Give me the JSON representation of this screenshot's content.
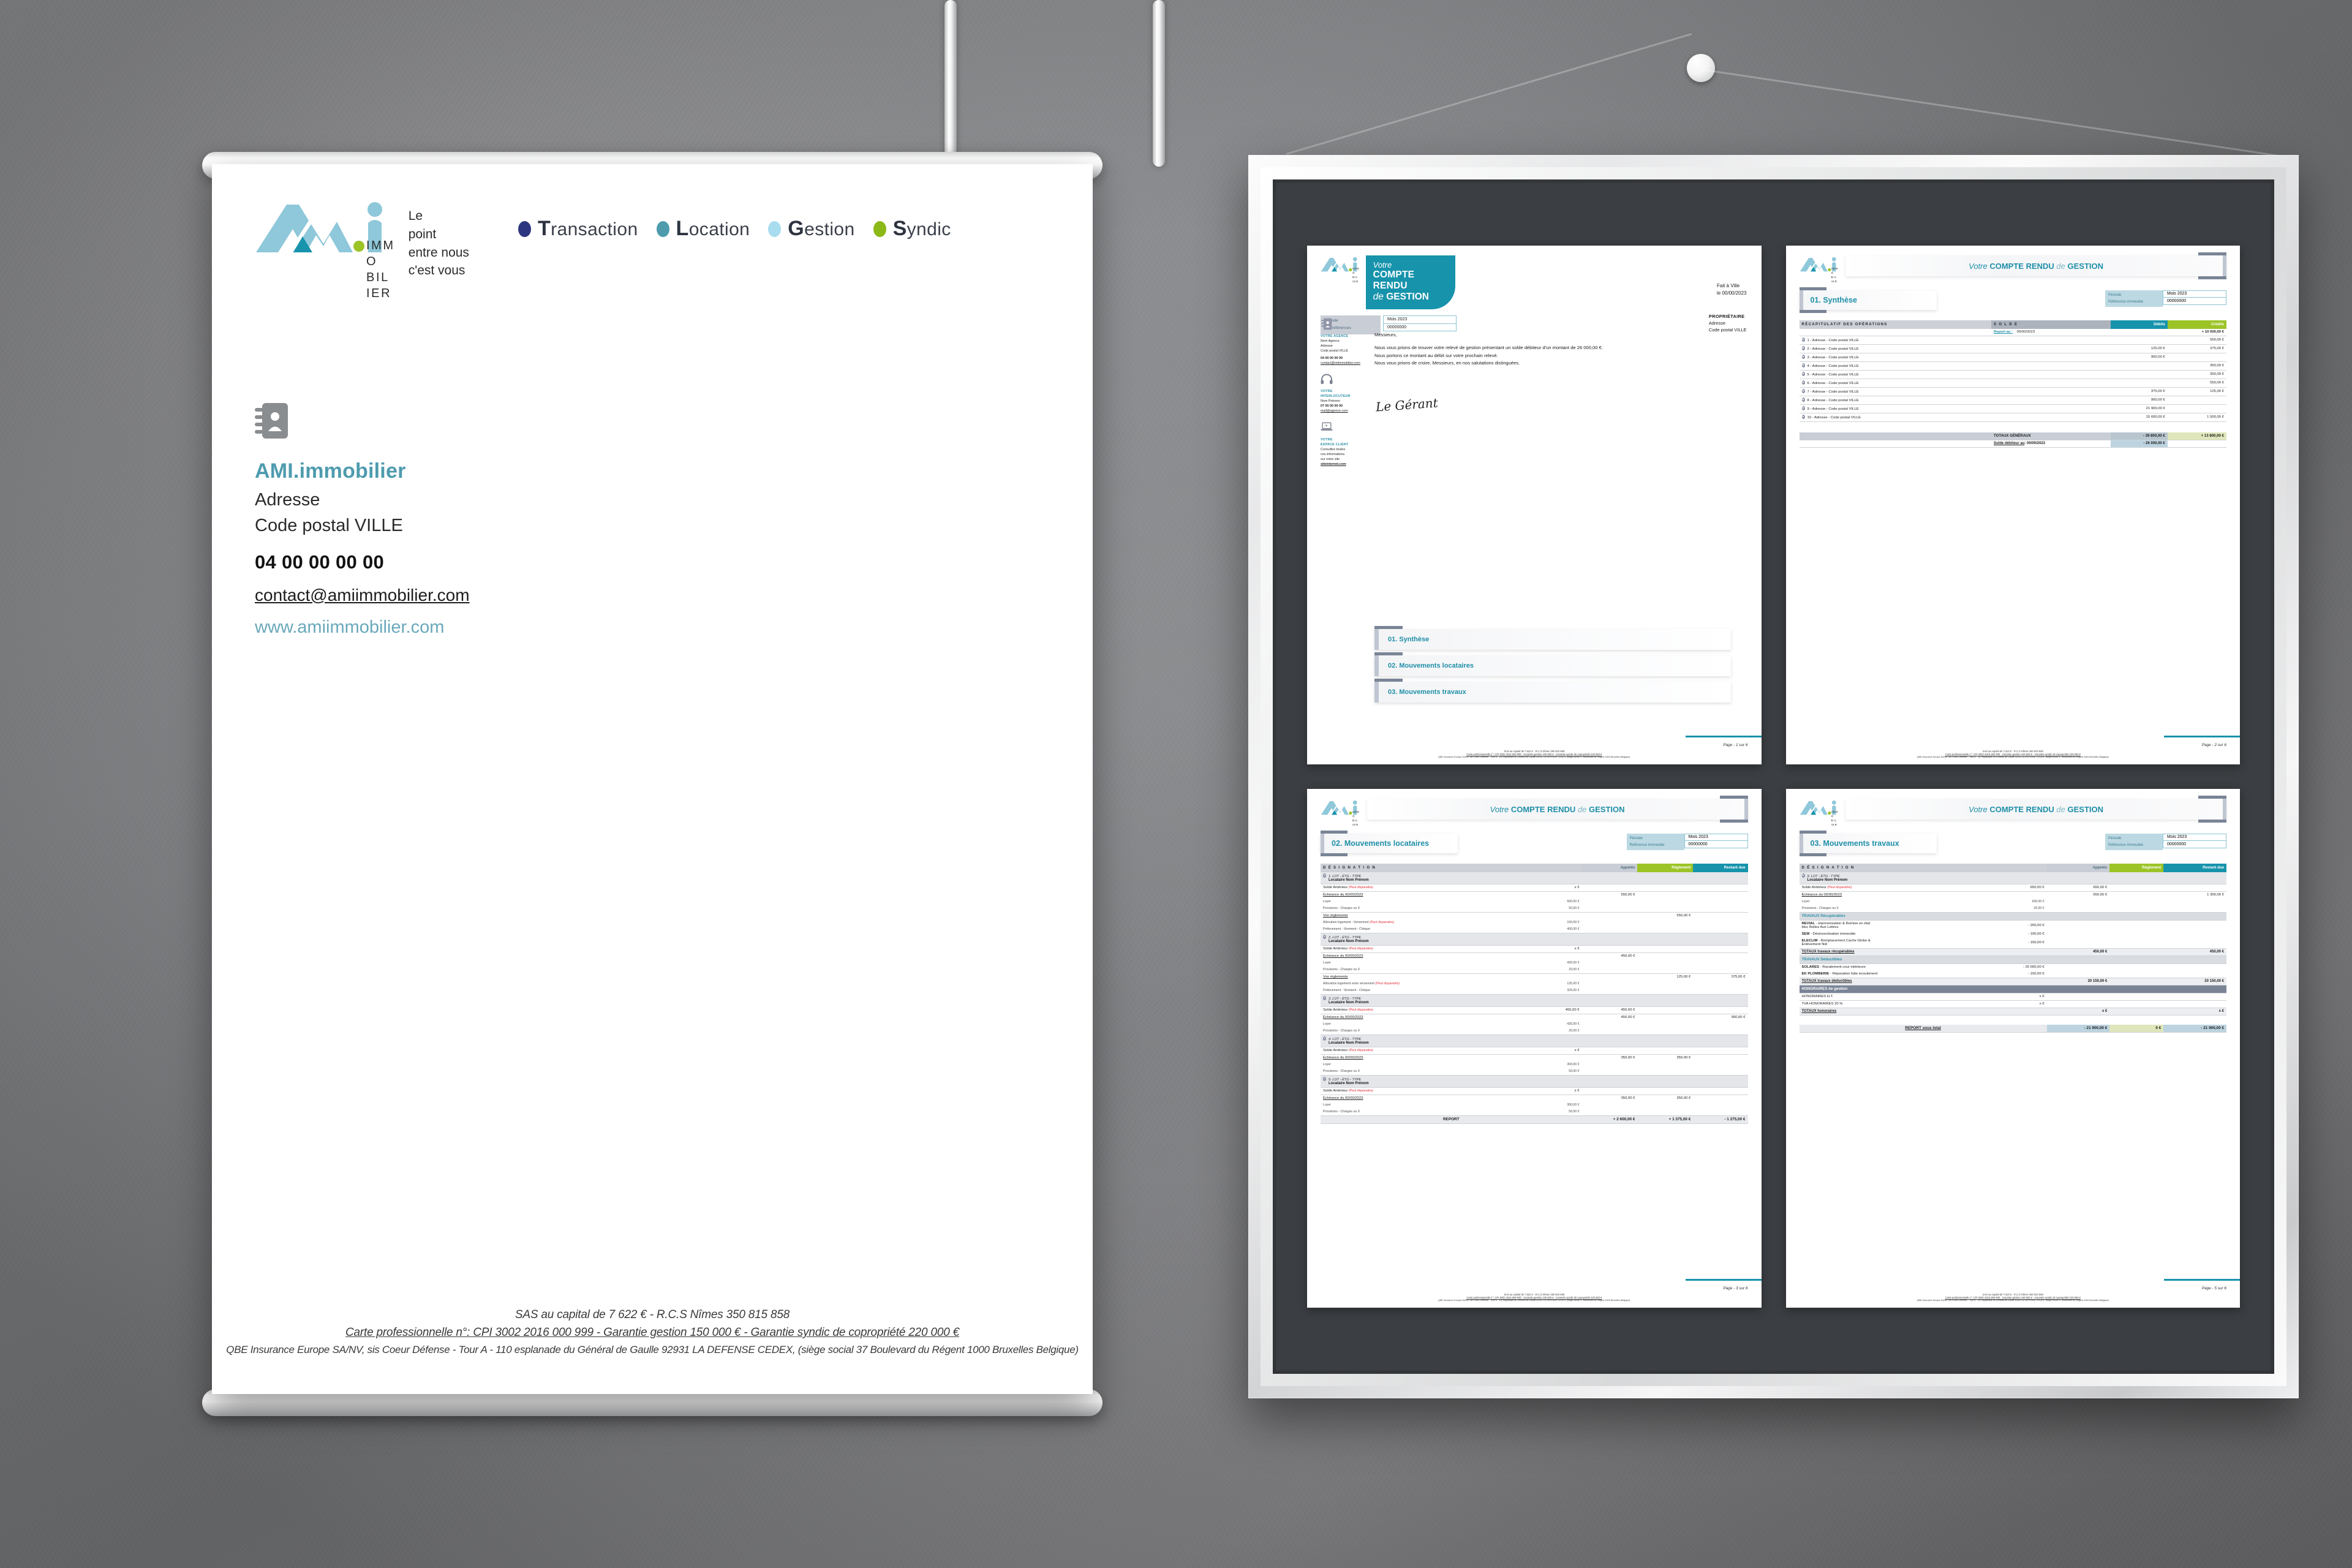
{
  "brand": {
    "name": "AMI.immobilier",
    "stack": [
      "IMM",
      "O",
      "BIL",
      "IER"
    ],
    "tagline": [
      "Le",
      "point",
      "entre nous",
      "c'est vous"
    ],
    "accent_teal": "#1793ac",
    "accent_light": "#8ec8da",
    "accent_green": "#9cc427",
    "accent_navy": "#2c3580"
  },
  "letterhead": {
    "nav": [
      {
        "label": "Transaction",
        "initial": "T",
        "color": "#2c3580"
      },
      {
        "label": "Location",
        "initial": "L",
        "color": "#4e9bae"
      },
      {
        "label": "Gestion",
        "initial": "G",
        "color": "#a8dcef"
      },
      {
        "label": "Syndic",
        "initial": "S",
        "color": "#8cb818"
      }
    ],
    "contact": {
      "name": "AMI.immobilier",
      "address": "Adresse",
      "city": "Code postal VILLE",
      "phone": "04 00 00 00 00",
      "email": "contact@amiimmobilier.com",
      "website": "www.amiimmobilier.com"
    },
    "footer": {
      "line1": "SAS au capital de 7 622 € - R.C.S Nîmes 350 815 858",
      "line2": "Carte professionnelle n°: CPI 3002 2016 000 999 - Garantie gestion 150 000 € - Garantie syndic de copropriété 220 000 €",
      "line3": "QBE Insurance Europe SA/NV, sis Coeur Défense - Tour A - 110 esplanade du Général de Gaulle 92931 LA DEFENSE CEDEX, (siège social 37 Boulevard du Régent 1000 Bruxelles Belgique)"
    }
  },
  "doc": {
    "title_votre": "Votre",
    "title_compte": "COMPTE",
    "title_rendu": "RENDU",
    "title_de": "de",
    "title_gestion": "GESTION",
    "header_inline": {
      "votre": "Votre ",
      "compte_rendu": "COMPTE RENDU",
      "de": " de ",
      "gestion": "GESTION"
    },
    "meta": {
      "periode_label": "Période",
      "periode_value": "Mois 2023",
      "refs_label": "Vos références",
      "refs_value": "00000000",
      "ref_immeuble_label": "Référence immeuble",
      "ref_immeuble_value": "00000000"
    },
    "fait": {
      "line1": "Fait à Ville",
      "line2": "le 00/00/2023"
    },
    "proprietaire": {
      "title": "PROPRIÉTAIRE",
      "address": "Adresse",
      "city": "Code postal VILLE"
    },
    "agence": {
      "heading": "VOTRE AGENCE",
      "name": "Nom Agence",
      "address": "Adresse",
      "city": "Code postal VILLE",
      "phone": "04 00 00 00 00",
      "email": "contact@mtimmobilier.com"
    },
    "interlocuteur": {
      "heading1": "VOTRE",
      "heading2": "INTERLOCUTEUR",
      "name": "Nom Prénom",
      "phone": "07 00 00 00 00",
      "email": "mail@agence.com"
    },
    "espace": {
      "heading1": "VOTRE",
      "heading2": "ESPACE CLIENT",
      "l1": "Consultez toutes",
      "l2": "vos informations",
      "l3": "sur notre site",
      "site": "siteinternet.com"
    },
    "letter": {
      "salutation": "Messieurs,",
      "p1": "Nous vous prions de trouver votre relevé de gestion présentant un solde débiteur d'un montant de 26 000,00 €.",
      "p2": "Nous portons ce montant au débit sur votre prochain relevé.",
      "p3": "Nous vous prions de croire, Messieurs, en nos salutations distinguées.",
      "signature": "Le Gérant"
    },
    "toc": [
      {
        "label": "01. Synthèse"
      },
      {
        "label": "02. Mouvements locataires"
      },
      {
        "label": "03. Mouvements travaux"
      }
    ],
    "pages": {
      "p1": "Page - 1 sur 6",
      "p2": "Page - 2 sur 6",
      "p3": "Page - 3 sur 6",
      "p5": "Page - 5 sur 6"
    },
    "footer": {
      "line1": "SAS au capital de 7 622 € - R.C.S Nîmes 350 815 858",
      "line2": "Carte professionnelle n°: CPI 3002 2016 000 999 - Garantie gestion 150 000 € - Garantie syndic de copropriété 220 000 €",
      "line3": "QBE Insurance Europe SA/NV, sis Coeur Défense - Tour A - 110 esplanade du Général de Gaulle 92931 LA DEFENSE CEDEX, (siège social 37 Boulevard du Régent 1000 Bruxelles Belgique)"
    }
  },
  "synthese": {
    "section_title": "01. Synthèse",
    "headers": {
      "desc": "RÉCAPITULATIF DES OPÉRATIONS",
      "solde": "S O L D E",
      "debits": "Débits",
      "credits": "Crédits"
    },
    "report": {
      "label": "Report au :",
      "date": "00/00/2023",
      "debit": "",
      "credit": "+ 10 000,00 €"
    },
    "rows": [
      {
        "label": "1 - Adresse - Code postal VILLE",
        "debit": "",
        "credit": "550,00 €"
      },
      {
        "label": "2 - Adresse - Code postal VILLE",
        "debit": "125,00 €",
        "credit": "375,00 €"
      },
      {
        "label": "3 - Adresse - Code postal VILLE",
        "debit": "900,00 €",
        "credit": ""
      },
      {
        "label": "4 - Adresse - Code postal VILLE",
        "debit": "",
        "credit": "350,00 €"
      },
      {
        "label": "5 - Adresse - Code postal VILLE",
        "debit": "",
        "credit": "350,00 €"
      },
      {
        "label": "6 - Adresse - Code postal VILLE",
        "debit": "",
        "credit": "550,00 €"
      },
      {
        "label": "7 - Adresse - Code postal VILLE",
        "debit": "375,00 €",
        "credit": "125,00 €"
      },
      {
        "label": "8 - Adresse - Code postal VILLE",
        "debit": "900,00 €",
        "credit": ""
      },
      {
        "label": "9 - Adresse - Code postal VILLE",
        "debit": "21 900,00 €",
        "credit": ""
      },
      {
        "label": "10 - Adresse - Code postal VILLE",
        "debit": "15 600,00 €",
        "credit": "1 500,00 €"
      }
    ],
    "totaux": {
      "label": "TOTAUX GÉNÉRAUX",
      "debit": "- 39 800,00 €",
      "credit": "+ 13 800,00 €"
    },
    "solde_final": {
      "label": "Solde débiteur au",
      "date": ": 00/00/2023",
      "value": "- 26 000,00 €"
    }
  },
  "locataires": {
    "section_title": "02. Mouvements locataires",
    "headers": {
      "desc": "D É S I G N A T I O N",
      "appeles": "Appelés",
      "reglement": "Règlement",
      "restant": "Restant due"
    },
    "groups": [
      {
        "lot": "1. LOT - ÉTG - TYPE",
        "tenant": "Locataire Nom Prénom",
        "lines": [
          {
            "label": "Solde Antérieur",
            "note": "(Peut disparaitre)",
            "amt": "x €",
            "appeles": "",
            "reglement": "",
            "restant": ""
          },
          {
            "label": "Échéance du 00/00/2023",
            "underline": true,
            "amt": "",
            "appeles": "550,00 €",
            "reglement": "",
            "restant": ""
          },
          {
            "label": "Loyer",
            "sub": true,
            "amt": "500,00 €"
          },
          {
            "label": "Provisions - Charges ou X",
            "sub": true,
            "amt": "50,00 €"
          },
          {
            "label": "Vos règlements",
            "underline": true,
            "amt": "",
            "appeles": "",
            "reglement": "550,00 €",
            "restant": ""
          },
          {
            "label": "Allocation logement - Versement",
            "note": "(Peut disparaitre)",
            "sub": true,
            "amt": "150,00 €"
          },
          {
            "label": "Prélevement - Virement - Chèque",
            "sub": true,
            "amt": "400,00 €"
          }
        ]
      },
      {
        "lot": "2. LOT - ÉTG - TYPE",
        "tenant": "Locataire Nom Prénom",
        "lines": [
          {
            "label": "Solde Antérieur",
            "note": "(Peut disparaitre)",
            "amt": "x €",
            "appeles": "",
            "reglement": "",
            "restant": ""
          },
          {
            "label": "Échéance du 00/00/2023",
            "underline": true,
            "amt": "",
            "appeles": "450,00 €",
            "reglement": "",
            "restant": ""
          },
          {
            "label": "Loyer",
            "sub": true,
            "amt": "430,00 €"
          },
          {
            "label": "Provisions - Charges ou X",
            "sub": true,
            "amt": "20,00 €"
          },
          {
            "label": "Vos règlements",
            "underline": true,
            "amt": "",
            "appeles": "",
            "reglement": "125,00 €",
            "restant": "375,00 €"
          },
          {
            "label": "Allocation logement votre versement",
            "note": "(Peut disparaitre)",
            "sub": true,
            "amt": "125,00 €"
          },
          {
            "label": "Prélevement - Virement - Chèque",
            "sub": true,
            "amt": "325,00 €"
          }
        ]
      },
      {
        "lot": "3. LOT - ÉTG - TYPE",
        "tenant": "Locataire Nom Prénom",
        "lines": [
          {
            "label": "Solde Antérieur",
            "note": "(Peut disparaitre)",
            "amt": "450,00 €",
            "appeles": "450,00 €",
            "reglement": "",
            "restant": ""
          },
          {
            "label": "Échéance du 00/00/2023",
            "underline": true,
            "amt": "",
            "appeles": "450,00 €",
            "reglement": "",
            "restant": "900,00 €"
          },
          {
            "label": "Loyer",
            "sub": true,
            "amt": "430,00 €"
          },
          {
            "label": "Provisions - Charges ou X",
            "sub": true,
            "amt": "20,00 €"
          }
        ]
      },
      {
        "lot": "4. LOT - ÉTG - TYPE",
        "tenant": "Locataire Nom Prénom",
        "lines": [
          {
            "label": "Solde Antérieur",
            "note": "(Peut disparaitre)",
            "amt": "x €",
            "appeles": "",
            "reglement": "",
            "restant": ""
          },
          {
            "label": "Échéance du 00/00/2023",
            "underline": true,
            "amt": "",
            "appeles": "350,00 €",
            "reglement": "350,00 €",
            "restant": ""
          },
          {
            "label": "Loyer",
            "sub": true,
            "amt": "300,00 €"
          },
          {
            "label": "Provisions - Charges ou X",
            "sub": true,
            "amt": "50,00 €"
          }
        ]
      },
      {
        "lot": "5. LOT - ÉTG - TYPE",
        "tenant": "Locataire Nom Prénom",
        "lines": [
          {
            "label": "Solde Antérieur",
            "note": "(Peut disparaitre)",
            "amt": "x €",
            "appeles": "",
            "reglement": "",
            "restant": ""
          },
          {
            "label": "Échéance du 00/00/2023",
            "underline": true,
            "amt": "",
            "appeles": "350,00 €",
            "reglement": "350,00 €",
            "restant": ""
          },
          {
            "label": "Loyer",
            "sub": true,
            "amt": "300,00 €"
          },
          {
            "label": "Provisions - Charges ou X",
            "sub": true,
            "amt": "50,00 €"
          }
        ]
      }
    ],
    "report": {
      "label": "REPORT",
      "appeles": "+ 2 600,00 €",
      "reglement": "+ 1 375,00 €",
      "restant": "- 1 275,00 €"
    }
  },
  "travaux": {
    "section_title": "03. Mouvements travaux",
    "headers": {
      "desc": "D É S I G N A T I O N",
      "appeles": "Appelés",
      "reglement": "Règlement",
      "restant": "Restant due"
    },
    "group": {
      "lot": "9. LOT - ÉTG - TYPE",
      "tenant": "Locataire Nom Prénom",
      "lines": [
        {
          "label": "Solde Antérieur",
          "note": "(Peut disparaitre)",
          "amt": "650,00 €",
          "appeles": "650,00 €",
          "reglement": "",
          "restant": ""
        },
        {
          "label": "Échéance du 00/00/2023",
          "underline": true,
          "amt": "",
          "appeles": "650,00 €",
          "reglement": "",
          "restant": "1 300,00 €"
        },
        {
          "label": "Loyer",
          "sub": true,
          "amt": "630,00 €"
        },
        {
          "label": "Provisions - Charges ou X",
          "sub": true,
          "amt": "20,00 €"
        }
      ]
    },
    "recuperables": {
      "title": "TRAVAUX Récupérables",
      "items": [
        {
          "bold": "REVIAL",
          "rest": " - Harmonisation & Remise en état",
          "l2": "bloc Boites Aux Lettres",
          "amt": "- 200,00 €"
        },
        {
          "bold": "SEM",
          "rest": " - Désinsectisation immeuble",
          "l2": "",
          "amt": "- 100,00 €"
        },
        {
          "bold": "ELECLIM",
          "rest": " - Remplacement Cache Globe &",
          "l2": "Enlèvement Nid",
          "amt": "- 150,00 €"
        }
      ],
      "total": {
        "label": "TOTAUX  travaux récupérables",
        "appeles": "450,00 €",
        "reglement": "",
        "restant": "450,00 €"
      }
    },
    "deductibles": {
      "title": "TRAVAUX Déductibles",
      "items": [
        {
          "bold": "SOLARES",
          "rest": " - Ravalement cour intérieure",
          "l2": "",
          "amt": "- 20 000,00 €"
        },
        {
          "bold": "EK PLOMBERIE",
          "rest": " - Réparation fuite écoulement",
          "l2": "",
          "amt": "- 150,00 €"
        }
      ],
      "total": {
        "label": "TOTAUX  travaux déductibles",
        "appeles": "20 150,00 €",
        "reglement": "",
        "restant": "20 150,00 €"
      }
    },
    "honoraires": {
      "title": "HONORAIRES de gestion",
      "items": [
        {
          "label": "HONORAIRES H.T.",
          "amt": "x €"
        },
        {
          "label": "TVA HONORAIRES 20 %",
          "amt": "x €"
        }
      ],
      "total": {
        "label": "TOTAUX  honoraires",
        "appeles": "x €",
        "reglement": "",
        "restant": "x €"
      }
    },
    "report": {
      "label": "REPORT sous total",
      "appeles": "- 21 900,00 €",
      "reglement": "0 €",
      "restant": "- 21 900,00 €"
    }
  }
}
